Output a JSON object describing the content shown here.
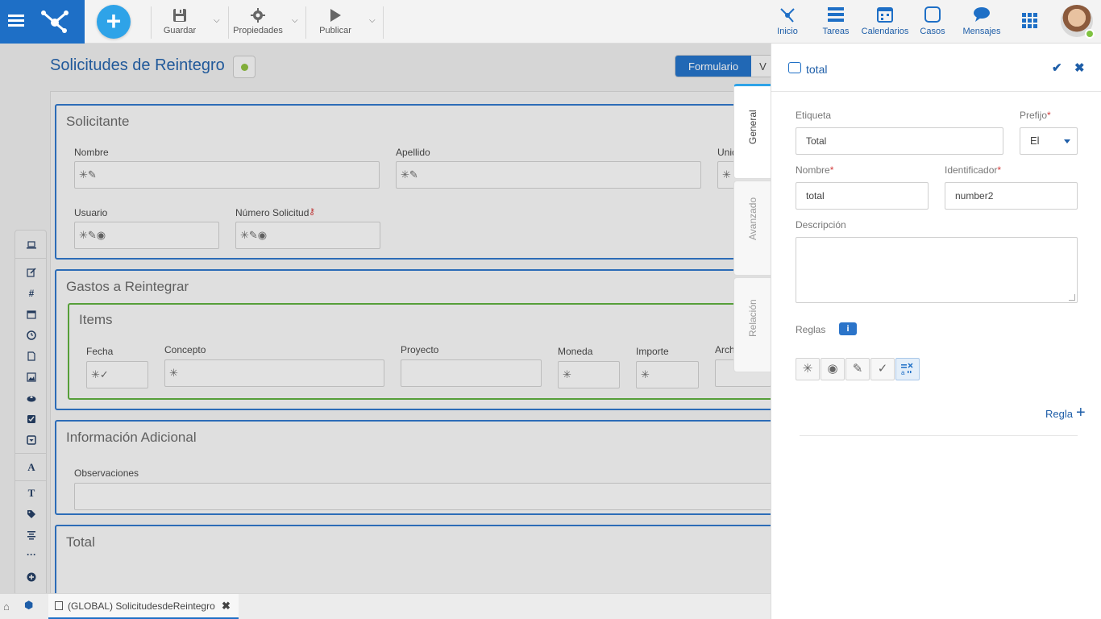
{
  "toolbar": {
    "save": "Guardar",
    "properties": "Propiedades",
    "publish": "Publicar"
  },
  "nav": {
    "home": "Inicio",
    "tasks": "Tareas",
    "calendars": "Calendarios",
    "cases": "Casos",
    "messages": "Mensajes"
  },
  "page": {
    "title": "Solicitudes de Reintegro",
    "view_active": "Formulario",
    "view_other": "V"
  },
  "form": {
    "section1": {
      "title": "Solicitante",
      "fields": {
        "nombre": "Nombre",
        "apellido": "Apellido",
        "unidad": "Unid",
        "usuario": "Usuario",
        "numero": "Número Solicitud"
      }
    },
    "section2": {
      "title": "Gastos a Reintegrar",
      "items_title": "Items",
      "columns": {
        "fecha": "Fecha",
        "concepto": "Concepto",
        "proyecto": "Proyecto",
        "moneda": "Moneda",
        "importe": "Importe",
        "archivo": "Arch"
      }
    },
    "section3": {
      "title": "Información Adicional",
      "observaciones": "Observaciones"
    },
    "section4": {
      "title": "Total"
    }
  },
  "side_tabs": {
    "general": "General",
    "advanced": "Avanzado",
    "relation": "Relación"
  },
  "panel": {
    "title": "total",
    "etiqueta_label": "Etiqueta",
    "etiqueta_value": "Total",
    "prefijo_label": "Prefijo",
    "prefijo_value": "El",
    "nombre_label": "Nombre",
    "nombre_value": "total",
    "identificador_label": "Identificador",
    "identificador_value": "number2",
    "descripcion_label": "Descripción",
    "reglas_label": "Reglas",
    "add_rule": "Regla"
  },
  "bottom": {
    "tab_label": "(GLOBAL) SolicitudesdeReintegro"
  },
  "colors": {
    "brand": "#1e6fc6",
    "accent": "#2ea3e8",
    "section_border": "#2b74c9",
    "items_border": "#5aad3a"
  }
}
